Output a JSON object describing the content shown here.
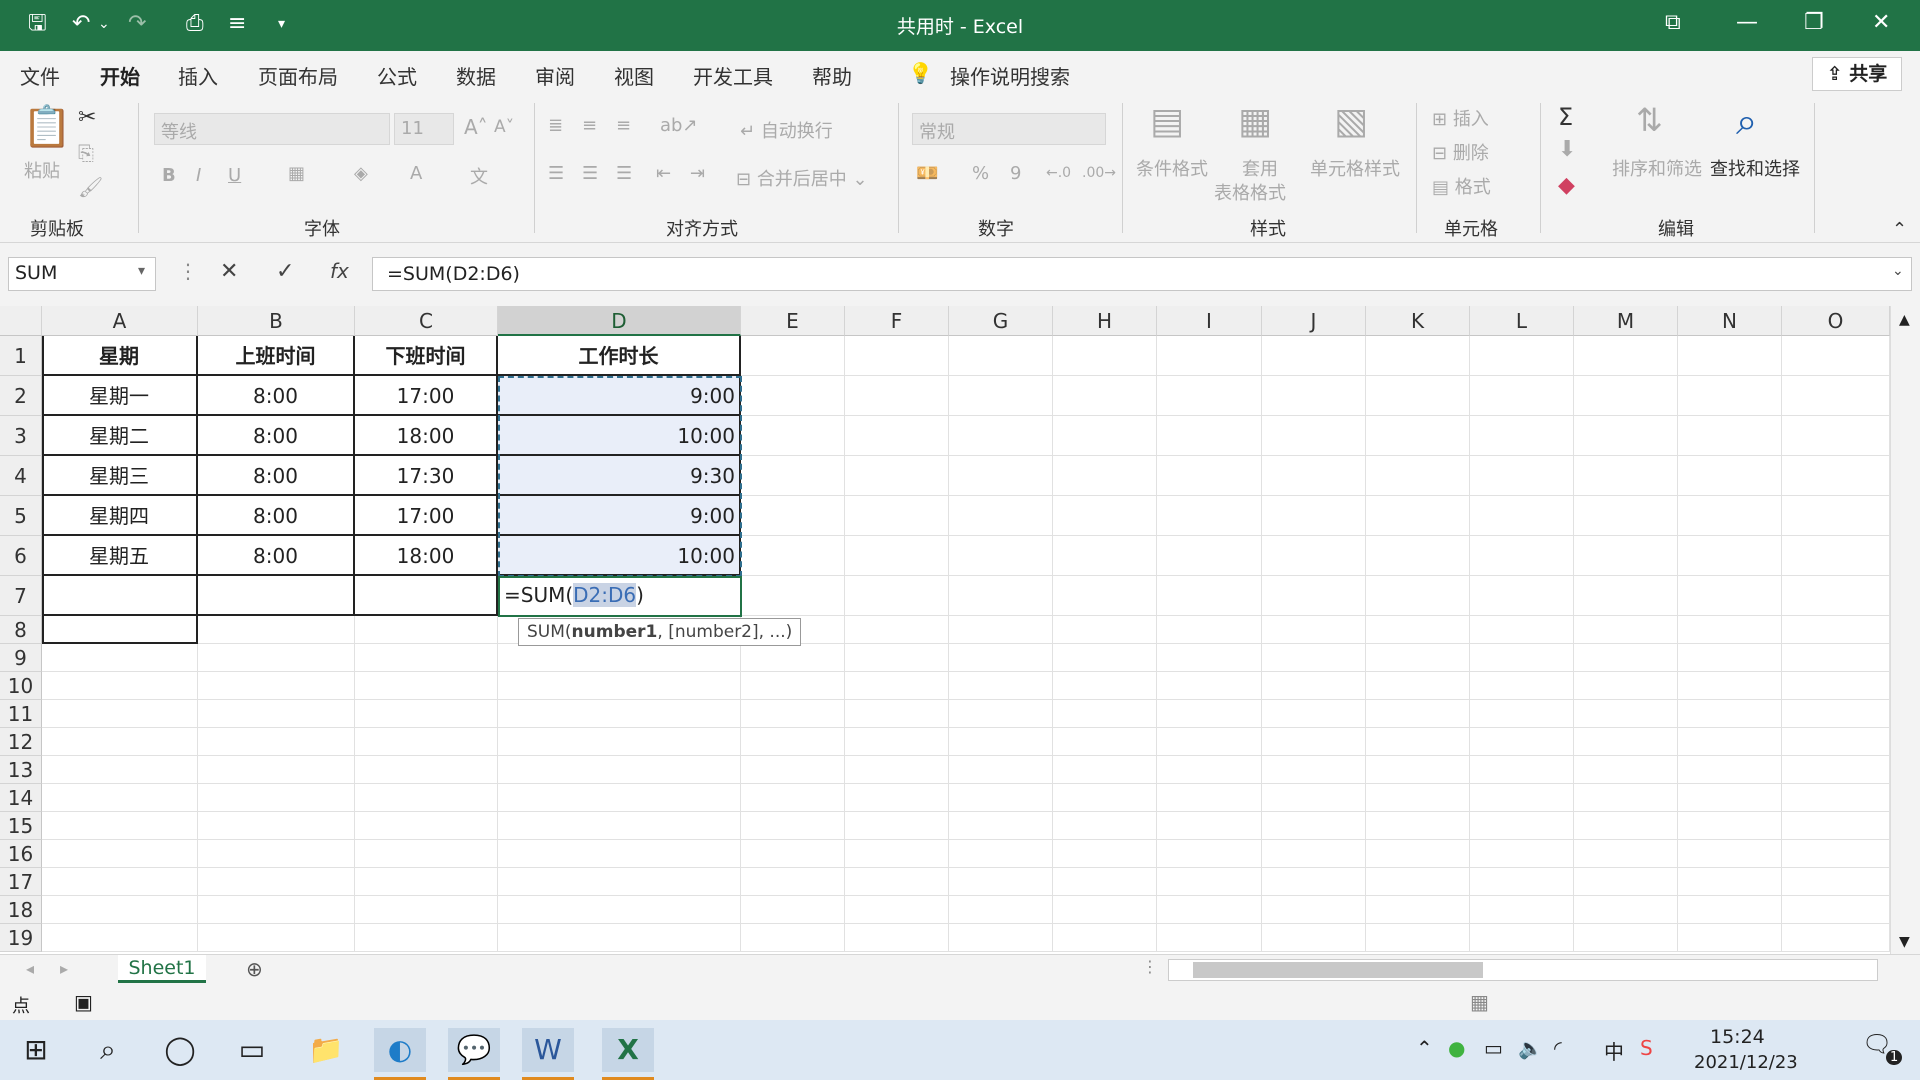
{
  "window": {
    "title": "共用时 - Excel"
  },
  "menu": {
    "tabs": [
      "文件",
      "开始",
      "插入",
      "页面布局",
      "公式",
      "数据",
      "审阅",
      "视图",
      "开发工具",
      "帮助"
    ],
    "active_tab": "开始",
    "tell_me": "操作说明搜索",
    "share": "共享"
  },
  "ribbon": {
    "clipboard": {
      "paste": "粘贴",
      "group": "剪贴板"
    },
    "font": {
      "name": "等线",
      "size": "11",
      "bold": "B",
      "italic": "I",
      "underline": "U",
      "group": "字体"
    },
    "alignment": {
      "wrap": "自动换行",
      "merge": "合并后居中",
      "group": "对齐方式"
    },
    "number": {
      "format": "常规",
      "percent": "%",
      "comma": "9",
      "group": "数字"
    },
    "styles": {
      "conditional": "条件格式",
      "table1": "套用",
      "table2": "表格格式",
      "cell_styles": "单元格样式",
      "group": "样式"
    },
    "cells": {
      "insert": "插入",
      "delete": "删除",
      "format": "格式",
      "group": "单元格"
    },
    "editing": {
      "sort": "排序和筛选",
      "find": "查找和选择",
      "group": "编辑"
    }
  },
  "formula_bar": {
    "name_box": "SUM",
    "formula": "=SUM(D2:D6)",
    "cancel": "✕",
    "enter": "✓",
    "fx": "fx"
  },
  "sheet": {
    "columns": [
      "A",
      "B",
      "C",
      "D",
      "E",
      "F",
      "G",
      "H",
      "I",
      "J",
      "K",
      "L",
      "M",
      "N",
      "O"
    ],
    "rows": [
      "1",
      "2",
      "3",
      "4",
      "5",
      "6",
      "7",
      "8",
      "9",
      "10",
      "11",
      "12",
      "13",
      "14",
      "15",
      "16",
      "17",
      "18",
      "19"
    ],
    "headers": [
      "星期",
      "上班时间",
      "下班时间",
      "工作时长"
    ],
    "data": [
      [
        "星期一",
        "8:00",
        "17:00",
        "9:00"
      ],
      [
        "星期二",
        "8:00",
        "18:00",
        "10:00"
      ],
      [
        "星期三",
        "8:00",
        "17:30",
        "9:30"
      ],
      [
        "星期四",
        "8:00",
        "17:00",
        "9:00"
      ],
      [
        "星期五",
        "8:00",
        "18:00",
        "10:00"
      ]
    ],
    "editing_cell": {
      "prefix": "=SUM(",
      "ref": "D2:D6",
      "suffix": ")"
    },
    "tooltip": {
      "func": "SUM(",
      "arg1": "number1",
      "rest": ", [number2], ...)"
    }
  },
  "sheet_tabs": {
    "active": "Sheet1"
  },
  "statusbar": {
    "mode": "点"
  },
  "taskbar": {
    "time": "15:24",
    "date": "2021/12/23",
    "ime": "中",
    "notifications": "1"
  }
}
